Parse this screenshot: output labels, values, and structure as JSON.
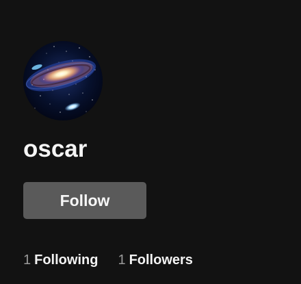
{
  "profile": {
    "username": "oscar",
    "avatar_icon": "galaxy-avatar-icon",
    "follow_label": "Follow",
    "following_count": "1",
    "following_label": "Following",
    "followers_count": "1",
    "followers_label": "Followers"
  },
  "colors": {
    "background": "#121212",
    "text": "#f2f2f2",
    "muted_count": "#9a9a9a",
    "follow_button": "#5a5a5a"
  }
}
